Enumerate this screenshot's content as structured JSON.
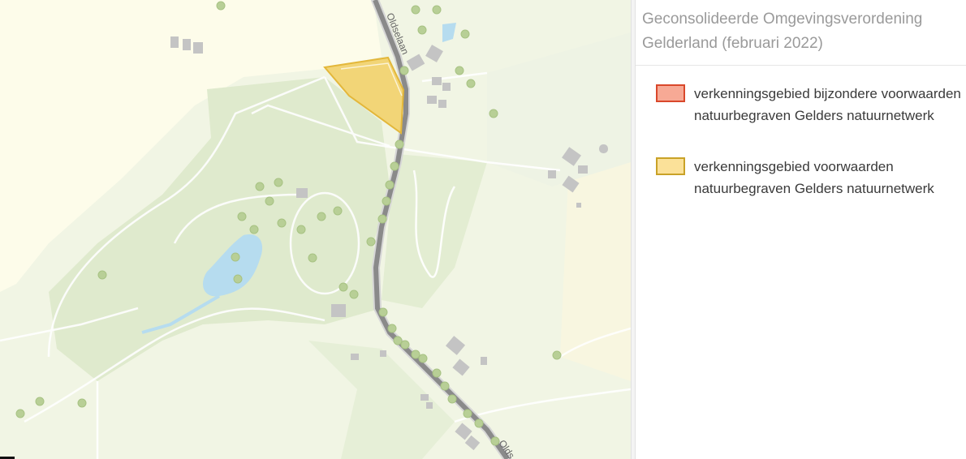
{
  "map": {
    "road_label": "Oldselaan",
    "road_label_bottom": "Olds"
  },
  "legend": {
    "title": "Geconsolideerde Omgevingsverordening Gelderland (februari 2022)",
    "items": [
      {
        "label": "verkenningsgebied bijzondere voorwaarden natuurbegraven Gelders natuurnetwerk",
        "fill": "#f7a995",
        "border": "#d9482b"
      },
      {
        "label": "verkenningsgebied voorwaarden natuurbegraven Gelders natuurnetwerk",
        "fill": "#fbe199",
        "border": "#c9a227"
      }
    ]
  },
  "colors": {
    "farmland": "#fdfcea",
    "meadow": "#eef3e0",
    "forest": "#dde9c9",
    "water": "#b6dcef",
    "road_main": "#8a8a8a",
    "tree": "#b8cf96",
    "building": "#c4c4c4",
    "highlight_area": "#f2cf64"
  }
}
